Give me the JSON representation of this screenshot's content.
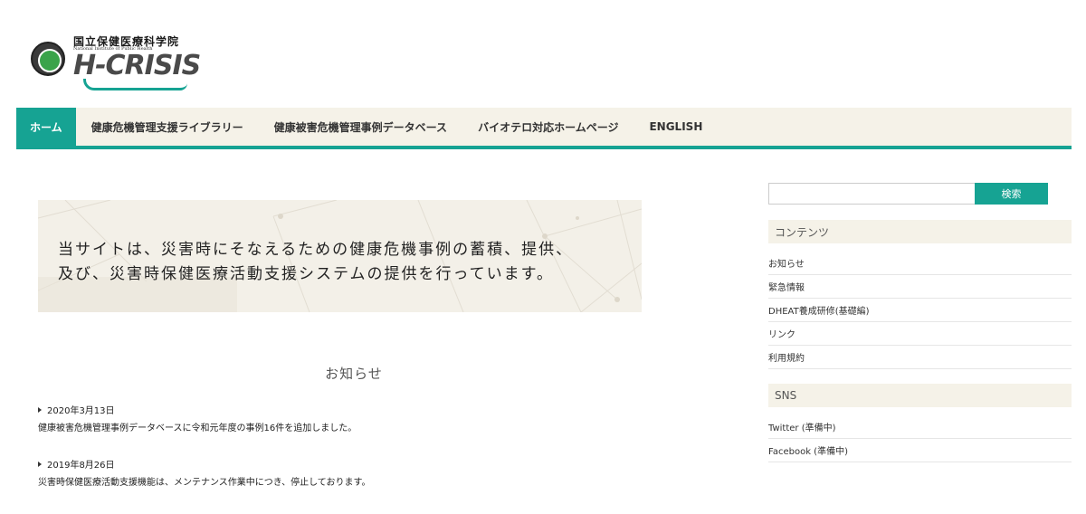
{
  "header": {
    "logo_jp": "国立保健医療科学院",
    "logo_en": "National Institute of Public Health",
    "logo_mark": "H-CRISIS"
  },
  "nav": {
    "items": [
      {
        "label": "ホーム",
        "active": true
      },
      {
        "label": "健康危機管理支援ライブラリー",
        "active": false
      },
      {
        "label": "健康被害危機管理事例データベース",
        "active": false
      },
      {
        "label": "バイオテロ対応ホームページ",
        "active": false
      },
      {
        "label": "ENGLISH",
        "active": false
      }
    ]
  },
  "banner": {
    "line1": "当サイトは、災害時にそなえるための健康危機事例の蓄積、提供、",
    "line2": "及び、災害時保健医療活動支援システムの提供を行っています。"
  },
  "news": {
    "heading": "お知らせ",
    "items": [
      {
        "date": "2020年3月13日",
        "text": "健康被害危機管理事例データベースに令和元年度の事例16件を追加しました。"
      },
      {
        "date": "2019年8月26日",
        "text": "災害時保健医療活動支援機能は、メンテナンス作業中につき、停止しております。"
      }
    ]
  },
  "sidebar": {
    "search": {
      "placeholder": "",
      "button_label": "検索"
    },
    "contents_heading": "コンテンツ",
    "contents_items": [
      "お知らせ",
      "緊急情報",
      "DHEAT養成研修(基礎編)",
      "リンク",
      "利用規約"
    ],
    "sns_heading": "SNS",
    "sns_items": [
      "Twitter (準備中)",
      "Facebook (準備中)"
    ]
  },
  "colors": {
    "accent": "#16a393",
    "nav_bg": "#f5f2e8",
    "banner_bg": "#f3f0e8"
  }
}
